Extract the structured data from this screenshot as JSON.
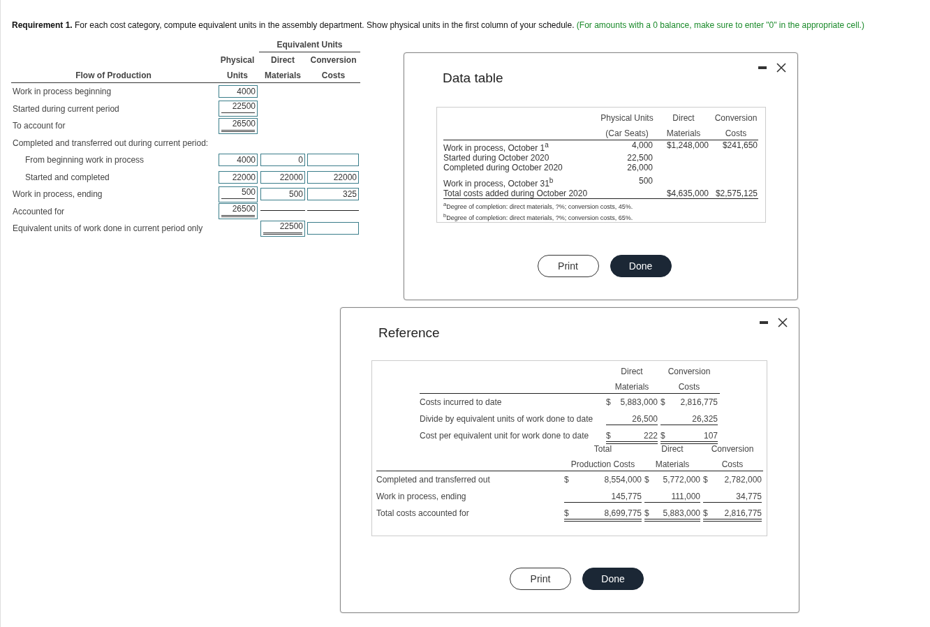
{
  "requirement": {
    "label": "Requirement 1.",
    "text": "For each cost category, compute equivalent units in the assembly department. Show physical units in the first column of your schedule.",
    "hint": "(For amounts with a 0 balance, make sure to enter \"0\" in the appropriate cell.)"
  },
  "worksheet": {
    "group_heading": "Equivalent Units",
    "label_heading": "Flow of Production",
    "columns": [
      {
        "top": "Physical",
        "bottom": "Units"
      },
      {
        "top": "Direct",
        "bottom": "Materials"
      },
      {
        "top": "Conversion",
        "bottom": "Costs"
      }
    ],
    "rows": [
      {
        "label": "Work in process beginning",
        "cells": [
          {
            "kind": "input",
            "value": "4000",
            "underline": false,
            "double": false
          },
          {
            "kind": "blank"
          },
          {
            "kind": "blank"
          }
        ]
      },
      {
        "label": "Started during current period",
        "cells": [
          {
            "kind": "input",
            "value": "22500",
            "underline": true,
            "double": false
          },
          {
            "kind": "blank"
          },
          {
            "kind": "blank"
          }
        ]
      },
      {
        "label": "To account for",
        "cells": [
          {
            "kind": "input",
            "value": "26500",
            "underline": true,
            "double": true
          },
          {
            "kind": "blank"
          },
          {
            "kind": "blank"
          }
        ]
      },
      {
        "label": "Completed and transferred out during current period:",
        "cells": [
          {
            "kind": "blank"
          },
          {
            "kind": "blank"
          },
          {
            "kind": "blank"
          }
        ],
        "children": [
          {
            "label": "From beginning work in process",
            "cells": [
              {
                "kind": "input",
                "value": "4000",
                "underline": false,
                "double": false
              },
              {
                "kind": "input",
                "value": "0",
                "underline": false,
                "double": false
              },
              {
                "kind": "input",
                "underline": false,
                "double": false
              }
            ]
          },
          {
            "label": "Started and completed",
            "cells": [
              {
                "kind": "input",
                "value": "22000",
                "underline": false,
                "double": false
              },
              {
                "kind": "input",
                "value": "22000",
                "underline": false,
                "double": false
              },
              {
                "kind": "input",
                "value": "22000",
                "underline": false,
                "double": false
              }
            ]
          }
        ]
      },
      {
        "label": "Work in process, ending",
        "cells": [
          {
            "kind": "input",
            "value": "500",
            "underline": true,
            "double": false
          },
          {
            "kind": "input",
            "value": "500",
            "underline": false,
            "double": false
          },
          {
            "kind": "input",
            "value": "325",
            "underline": false,
            "double": false
          }
        ]
      },
      {
        "label": "Accounted for",
        "cells": [
          {
            "kind": "input",
            "value": "26500",
            "underline": true,
            "double": true
          },
          {
            "kind": "line"
          },
          {
            "kind": "line"
          }
        ]
      },
      {
        "label": "Equivalent units of work done in current period only",
        "cells": [
          {
            "kind": "blank"
          },
          {
            "kind": "input",
            "value": "22500",
            "underline": true,
            "double": true
          },
          {
            "kind": "input",
            "underline": false,
            "double": false
          }
        ]
      }
    ]
  },
  "data_window": {
    "title": "Data table",
    "columns": [
      {
        "top": "Physical Units",
        "bottom": "(Car Seats)"
      },
      {
        "top": "Direct",
        "bottom": "Materials"
      },
      {
        "top": "Conversion",
        "bottom": "Costs"
      }
    ],
    "rows": [
      {
        "label": "Work in process, October 1$^{a}$",
        "cells": [
          "4,000",
          "$1,248,000",
          "$241,650"
        ]
      },
      {
        "label": "Started during October 2020",
        "cells": [
          "22,500",
          "",
          ""
        ]
      },
      {
        "label": "Completed during October 2020",
        "cells": [
          "26,000",
          "",
          ""
        ]
      },
      {
        "label": "Work in process, October 31$^{b}$",
        "cells": [
          "500",
          "",
          ""
        ]
      },
      {
        "label": "Total costs added during October 2020",
        "cells": [
          "",
          "$4,635,000",
          "$2,575,125"
        ]
      }
    ],
    "footnotes": [
      "$^{a}$Degree of completion: direct materials, ?%; conversion costs, 45%.",
      "$^{b}$Degree of completion: direct materials, ?%; conversion costs, 65%."
    ],
    "buttons": [
      {
        "label": "Print",
        "kind": "secondary"
      },
      {
        "label": "Done",
        "kind": "primary"
      }
    ]
  },
  "reference_window": {
    "title": "Reference",
    "unit_cost_table": {
      "columns": [
        {
          "top": "Direct",
          "bottom": "Materials"
        },
        {
          "top": "Conversion",
          "bottom": "Costs"
        }
      ],
      "rows": [
        {
          "label": "Costs incurred to date",
          "cells": [
            {
              "sign": "$",
              "value": "5,883,000",
              "underline": false,
              "double": false
            },
            {
              "sign": "$",
              "value": "2,816,775",
              "underline": false,
              "double": false
            }
          ]
        },
        {
          "label": "Divide by equivalent units of work done to date",
          "cells": [
            {
              "value": "26,500",
              "underline": true,
              "double": false
            },
            {
              "value": "26,325",
              "underline": true,
              "double": false
            }
          ]
        },
        {
          "label": "Cost per equivalent unit for work done to date",
          "cells": [
            {
              "sign": "$",
              "value": "222",
              "underline": true,
              "double": true
            },
            {
              "sign": "$",
              "value": "107",
              "underline": true,
              "double": true
            }
          ]
        }
      ]
    },
    "assignment_table": {
      "columns": [
        {
          "top": "Total",
          "bottom": "Production Costs"
        },
        {
          "top": "Direct",
          "bottom": "Materials"
        },
        {
          "top": "Conversion",
          "bottom": "Costs"
        }
      ],
      "rows": [
        {
          "label": "Completed and transferred out",
          "cells": [
            {
              "sign": "$",
              "value": "8,554,000",
              "underline": false,
              "double": false
            },
            {
              "sign": "$",
              "value": "5,772,000",
              "underline": false,
              "double": false
            },
            {
              "sign": "$",
              "value": "2,782,000",
              "underline": false,
              "double": false
            }
          ]
        },
        {
          "label": "Work in process, ending",
          "cells": [
            {
              "value": "145,775",
              "underline": true,
              "double": false
            },
            {
              "value": "111,000",
              "underline": true,
              "double": false
            },
            {
              "value": "34,775",
              "underline": true,
              "double": false
            }
          ]
        },
        {
          "label": "Total costs accounted for",
          "cells": [
            {
              "sign": "$",
              "value": "8,699,775",
              "underline": true,
              "double": true
            },
            {
              "sign": "$",
              "value": "5,883,000",
              "underline": true,
              "double": true
            },
            {
              "sign": "$",
              "value": "2,816,775",
              "underline": true,
              "double": true
            }
          ]
        }
      ]
    },
    "buttons": [
      {
        "label": "Print",
        "kind": "secondary"
      },
      {
        "label": "Done",
        "kind": "primary"
      }
    ]
  }
}
